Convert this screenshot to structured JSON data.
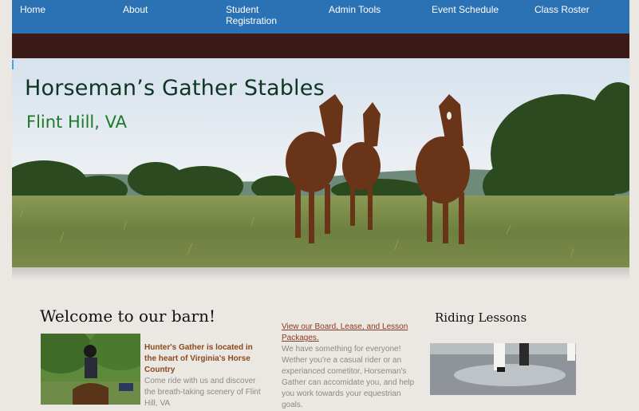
{
  "nav": {
    "items": [
      "Home",
      "About",
      "Student Registration",
      "Admin Tools",
      "Event Schedule",
      "Class Roster"
    ]
  },
  "hero": {
    "title": "Horseman’s Gather Stables",
    "subtitle": "Flint Hill, VA"
  },
  "content": {
    "welcome_heading": "Welcome to our barn!",
    "intro_bold": "Hunter's Gather is located in the heart of Virginia's Horse Country",
    "intro_text": "Come ride with us and discover the breath-taking scenery of Flint Hill, VA",
    "packages_link": "View our Board, Lease, and Lesson Packages.",
    "packages_text": "We have something for everyone! Wether you're a casual rider or an experianced cometitor, Horseman's Gather can accomidate you, and help you work towards your equestrian goals.",
    "lessons_heading": "Riding Lessons"
  },
  "colors": {
    "nav_bg": "#2b72b5",
    "bar_bg": "#3b1b17",
    "page_bg": "#ebe7e3",
    "link": "#8a3a1e"
  }
}
